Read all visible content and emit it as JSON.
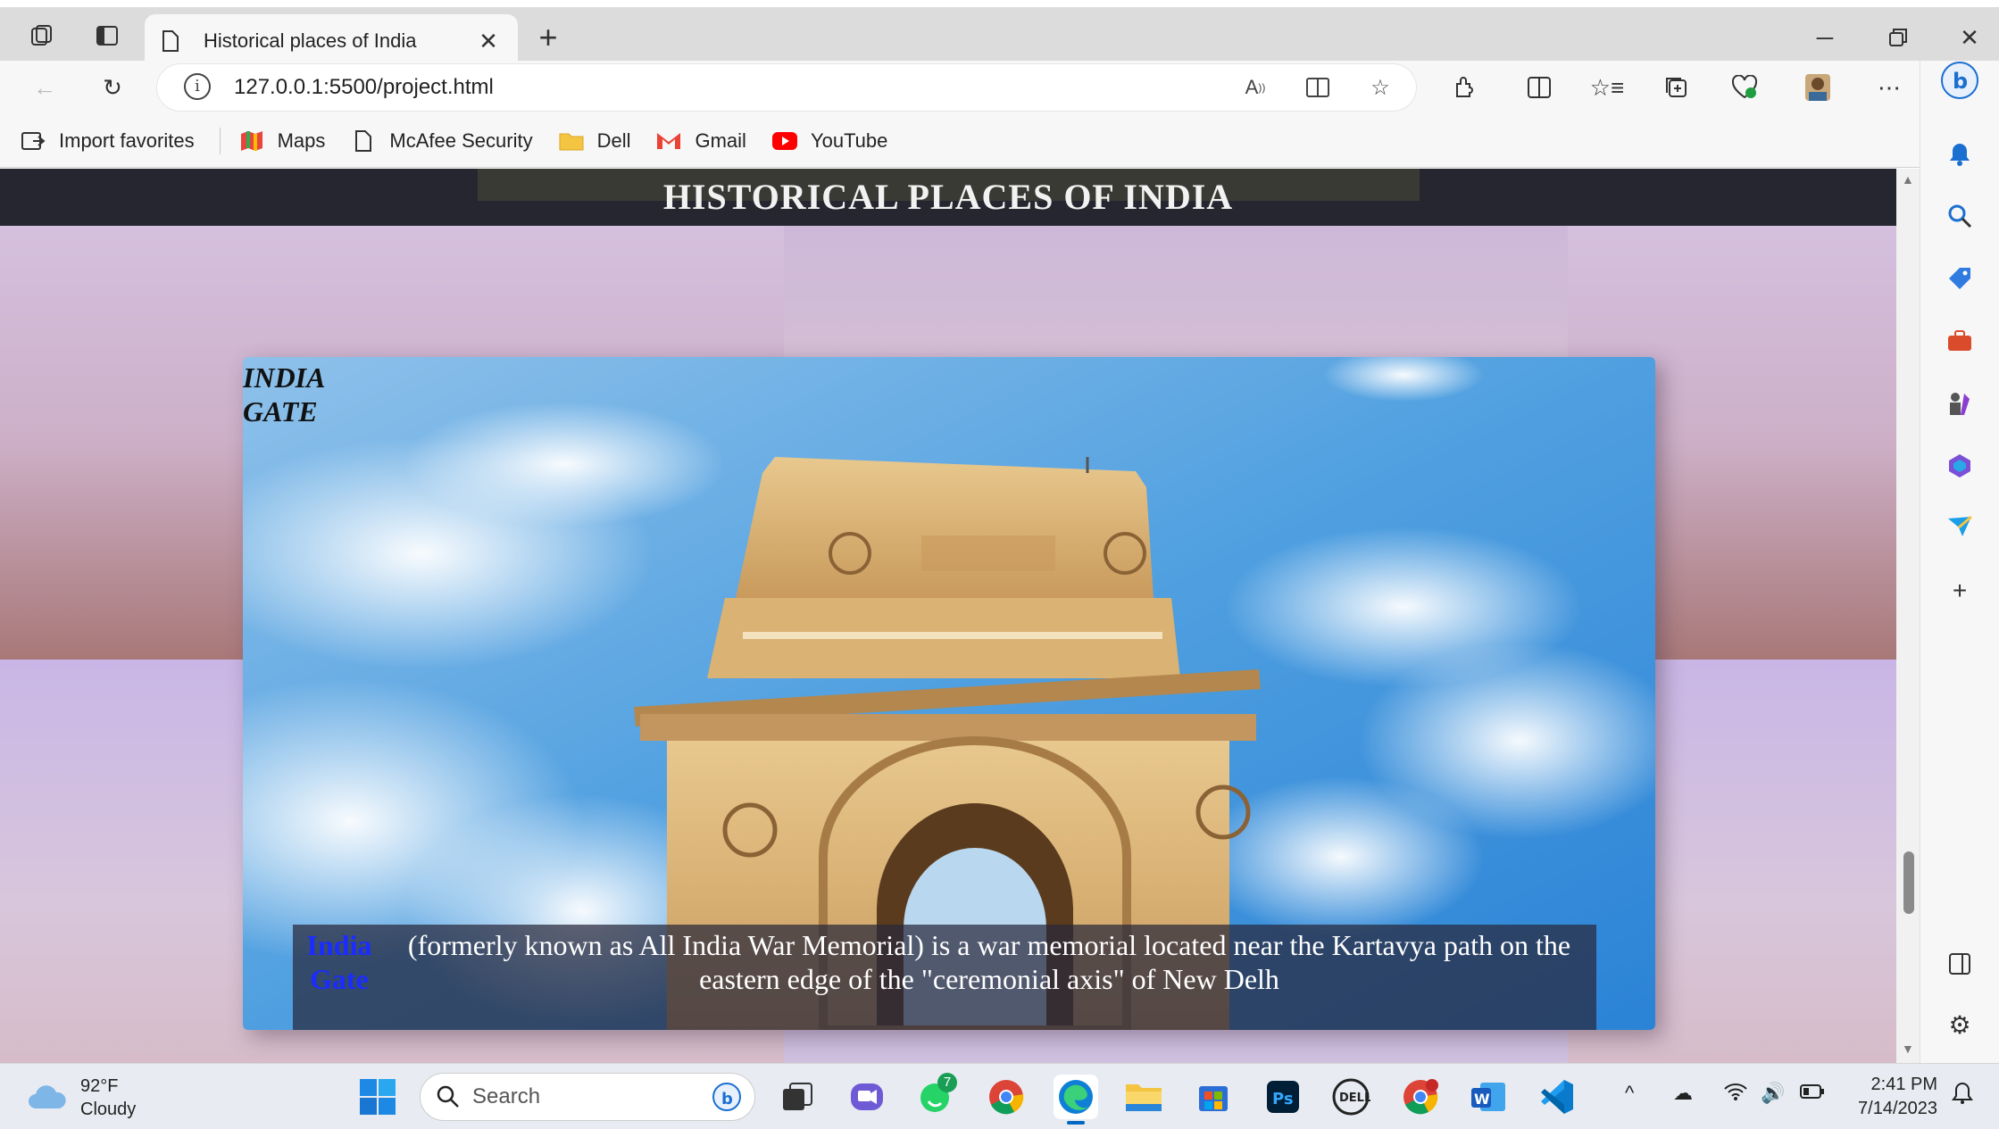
{
  "browser": {
    "tab": {
      "title": "Historical places of India",
      "close": "✕"
    },
    "address": "127.0.0.1:5500/project.html",
    "bookmarks": [
      {
        "label": "Import favorites",
        "icon": "import-icon"
      },
      {
        "label": "Maps",
        "icon": "maps-icon"
      },
      {
        "label": "McAfee Security",
        "icon": "page-icon"
      },
      {
        "label": "Dell",
        "icon": "folder-icon"
      },
      {
        "label": "Gmail",
        "icon": "gmail-icon"
      },
      {
        "label": "YouTube",
        "icon": "youtube-icon"
      }
    ]
  },
  "page": {
    "header_title": "HISTORICAL PLACES OF INDIA",
    "card_label": "INDIA GATE",
    "caption_title": "India Gate",
    "caption_text": "(formerly known as All India War Memorial) is a war memorial located near the Kartavya path on the eastern edge of the \"ceremonial axis\" of New Delh"
  },
  "taskbar": {
    "weather": {
      "temp": "92°F",
      "condition": "Cloudy"
    },
    "search_placeholder": "Search",
    "whatsapp_badge": "7",
    "time": "2:41 PM",
    "date": "7/14/2023"
  },
  "colors": {
    "accent": "#0067c0",
    "header_bg": "#262630",
    "caption_title": "#1a2cff"
  }
}
